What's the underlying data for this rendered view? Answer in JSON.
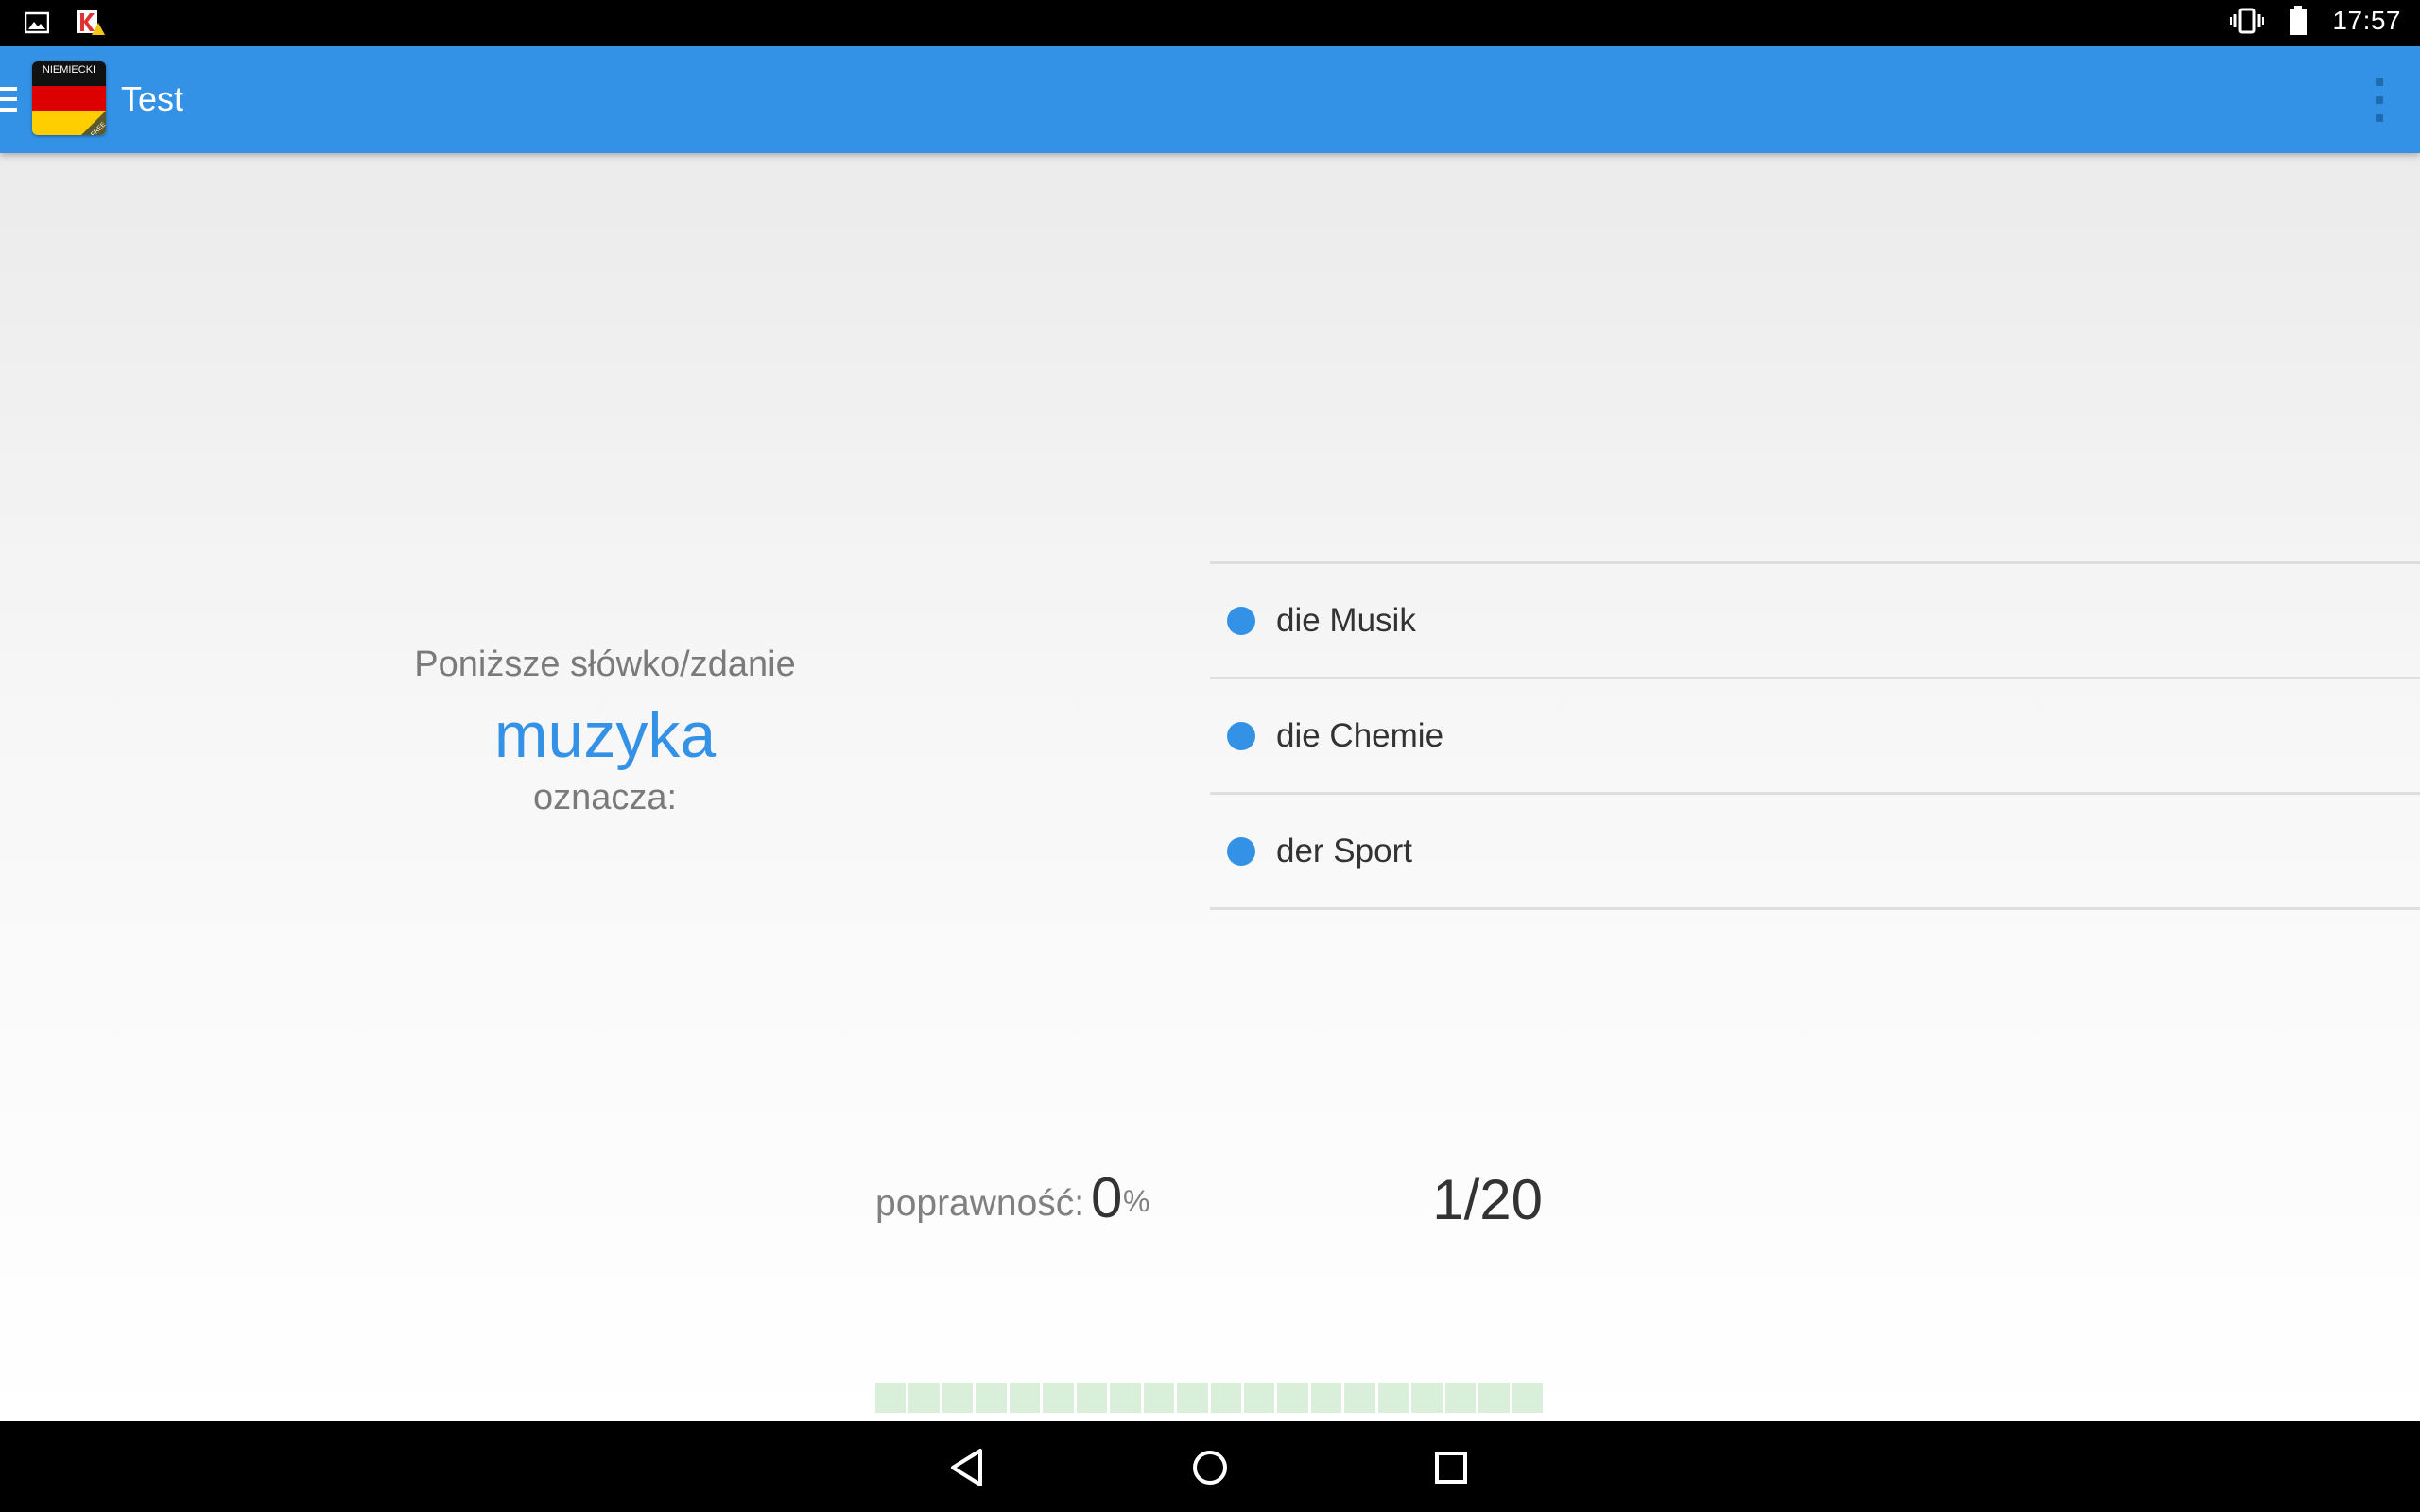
{
  "status_bar": {
    "time": "17:57",
    "left_icons": [
      "image-notification-icon",
      "kaspersky-notification-icon"
    ],
    "right_icons": [
      "vibrate-icon",
      "battery-icon"
    ]
  },
  "app_bar": {
    "title": "Test",
    "app_icon_label": "NIEMIECKI",
    "app_icon_corner": "FREE",
    "color": "#3392e6"
  },
  "question": {
    "prefix": "Poniższe słówko/zdanie",
    "word": "muzyka",
    "suffix": "oznacza:"
  },
  "answers": [
    {
      "label": "die Musik"
    },
    {
      "label": "die Chemie"
    },
    {
      "label": "der Sport"
    }
  ],
  "score": {
    "label": "poprawność:",
    "value": "0",
    "unit": "%"
  },
  "progress": {
    "current": 1,
    "total": 20,
    "display": "1/20",
    "segment_count": 20
  },
  "colors": {
    "accent": "#3392e6",
    "segment": "#d9efda"
  }
}
